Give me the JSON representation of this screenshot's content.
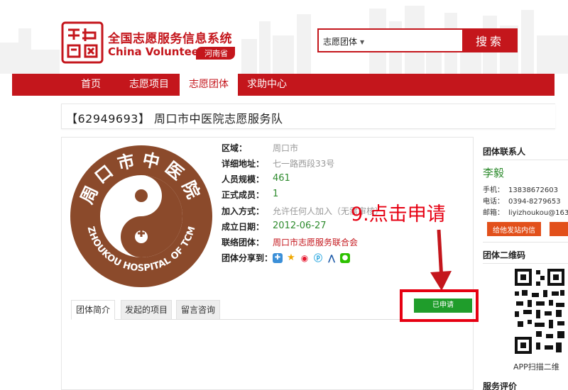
{
  "header": {
    "logo_text": "志愿中国",
    "title_cn": "全国志愿服务信息系统",
    "title_en": "China Volunteer",
    "province": "河南省",
    "search": {
      "category": "志愿团体",
      "value": "",
      "button_label": "搜索"
    }
  },
  "nav": {
    "tabs": [
      {
        "label": "首页"
      },
      {
        "label": "志愿项目"
      },
      {
        "label": "志愿团体"
      },
      {
        "label": "求助中心"
      }
    ],
    "active": "志愿团体"
  },
  "org": {
    "title": "【62949693】 周口市中医院志愿服务队",
    "logo_text_top": "周口市中医院",
    "logo_text_bottom": "ZHOUKOU HOSPITAL OF TCM",
    "info": [
      {
        "label": "区域：",
        "value": "周口市"
      },
      {
        "label": "详细地址：",
        "value": "七一路西段33号"
      },
      {
        "label": "人员规模：",
        "value": "461"
      },
      {
        "label": "正式成员：",
        "value": "1"
      },
      {
        "label": "加入方式：",
        "value": "允许任何人加入（无需审核）"
      },
      {
        "label": "成立日期：",
        "value": "2012-06-27"
      },
      {
        "label": "联络团体：",
        "value": "周口市志愿服务联合会"
      },
      {
        "label": "团体分享到：",
        "value": ""
      }
    ],
    "share_icons": [
      "qzone-icon",
      "star-icon",
      "weibo-icon",
      "pengyou-icon",
      "renren-icon",
      "wechat-icon"
    ],
    "tabs": [
      {
        "label": "团体简介"
      },
      {
        "label": "发起的项目"
      },
      {
        "label": "留言咨询"
      }
    ],
    "applied_button_label": "已申请"
  },
  "annotation": {
    "text": "9.点击申请"
  },
  "sidebar": {
    "contact_heading": "团体联系人",
    "contact_name": "李毅",
    "phone_label": "手机：",
    "phone": "13838672603",
    "tel_label": "电话：",
    "tel": "0394-8279653",
    "email_label": "邮箱：",
    "email": "liyizhoukou@163",
    "message_button": "给他发站内信",
    "qr_heading": "团体二维码",
    "qr_caption": "APP扫描二维",
    "rating_heading": "服务评价"
  },
  "colors": {
    "brand_red": "#c4161c",
    "annotation_red": "#e60012",
    "green": "#1f9d2b",
    "logo_brown": "#8b4a2b"
  }
}
